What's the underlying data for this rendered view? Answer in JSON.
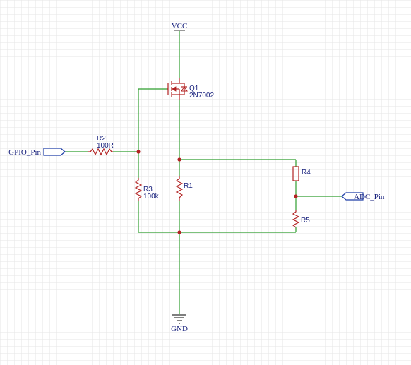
{
  "nets": {
    "vcc": "VCC",
    "gnd": "GND",
    "gpio_port": "GPIO_Pin",
    "adc_port": "ADC_Pin"
  },
  "components": {
    "q1": {
      "designator": "Q1",
      "value": "2N7002"
    },
    "r1": {
      "designator": "R1"
    },
    "r2": {
      "designator": "R2",
      "value": "100R"
    },
    "r3": {
      "designator": "R3",
      "value": "100k"
    },
    "r4": {
      "designator": "R4"
    },
    "r5": {
      "designator": "R5"
    }
  },
  "colors": {
    "wire": "#2e9e2e",
    "component": "#b22222",
    "label": "#1a237e",
    "port": "#1f3fa8",
    "grid": "#e6e6e6"
  }
}
